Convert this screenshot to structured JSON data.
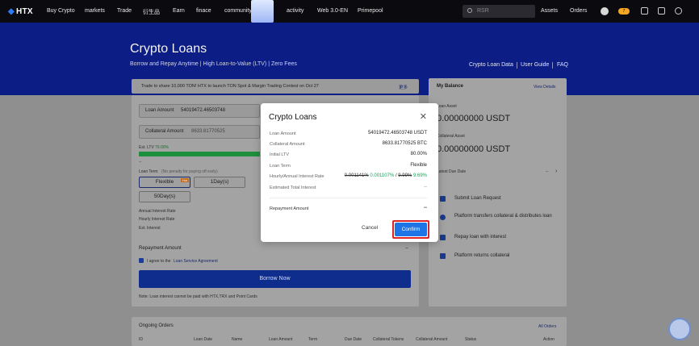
{
  "nav": {
    "logo": "HTX",
    "items": [
      "Buy Crypto",
      "markets",
      "Trade",
      "衍生品",
      "Earn",
      "finace",
      "community",
      "activity",
      "Web 3.0-EN",
      "Primepool"
    ],
    "search_placeholder": "RSR",
    "assets": "Assets",
    "orders": "Orders",
    "badge": "7"
  },
  "hero": {
    "title": "Crypto Loans",
    "subtitle": "Borrow and Repay Anytime | High Loan-to-Value (LTV) | Zero Fees",
    "links": [
      "Crypto Loan Data",
      "User Guide",
      "FAQ"
    ]
  },
  "announcement": {
    "text": "Trade to share 10,000 TON! HTX to launch TON Spot & Margin Trading Contest on Oct 27",
    "more": "更多"
  },
  "form": {
    "loan_amount_label": "Loan Amount",
    "loan_amount_value": "54019472.46503748",
    "collateral_label": "Collateral Amount",
    "collateral_value": "8633.81770525",
    "est_ltv_label": "Est. LTV",
    "est_ltv_value": "79.00%",
    "ltv_dash": "--",
    "loan_term_label": "Loan Term",
    "loan_term_note": "(No penalty for paying off early)",
    "terms": [
      "Flexible",
      "1Day(s)",
      "50Day(s)"
    ],
    "flexible_tag": "Hot",
    "annual_rate_label": "Annual Interest Rate",
    "hourly_rate_label": "Hourly Interest Rate",
    "est_interest_label": "Est. Interest",
    "repayment_label": "Repayment Amount",
    "repayment_value": "--",
    "agree_prefix": "I agree to the",
    "agree_link": "Loan Service Agreement",
    "borrow_button": "Borrow Now",
    "note": "Note: Loan interest cannot be paid with HTX,TRX and Point Cards"
  },
  "balance": {
    "title": "My Balance",
    "view_details": "View Details",
    "loan_asset_label": "Loan Asset",
    "loan_asset_value": "0.00000000 USDT",
    "collateral_asset_label": "Collateral Asset",
    "collateral_asset_value": "0.00000000 USDT",
    "latest_due_label": "Latest Due Date",
    "latest_due_value": "--",
    "steps": [
      "Submit Loan Request",
      "Platform transfers collateral & distributes loan",
      "Repay loan with interest",
      "Platform returns collateral"
    ]
  },
  "orders": {
    "title": "Ongoing Orders",
    "all_orders": "All Orders",
    "columns": [
      "ID",
      "Loan Date",
      "Name",
      "Loan Amount",
      "Term",
      "Due Date",
      "Collateral Tokens",
      "Collateral Amount",
      "Status",
      "Action"
    ]
  },
  "modal": {
    "title": "Crypto Loans",
    "rows": [
      {
        "label": "Loan Amount",
        "value": "54019472.46503748 USDT"
      },
      {
        "label": "Collateral Amount",
        "value": "8633.81770525 BTC"
      },
      {
        "label": "Initial LTV",
        "value": "80.00%"
      },
      {
        "label": "Loan Term",
        "value": "Flexible"
      }
    ],
    "rate_label": "Hourly/Annual Interest Rate",
    "rate_old": "0.001141%",
    "rate_new": "0.001107%",
    "rate_sep": "/",
    "rate_old_annual": "9.99%",
    "rate_new_annual": "9.69%",
    "est_total_label": "Estimated Total Interest",
    "est_total_value": "--",
    "repayment_label": "Repayment Amount",
    "repayment_value": "--",
    "cancel": "Cancel",
    "confirm": "Confirm"
  }
}
